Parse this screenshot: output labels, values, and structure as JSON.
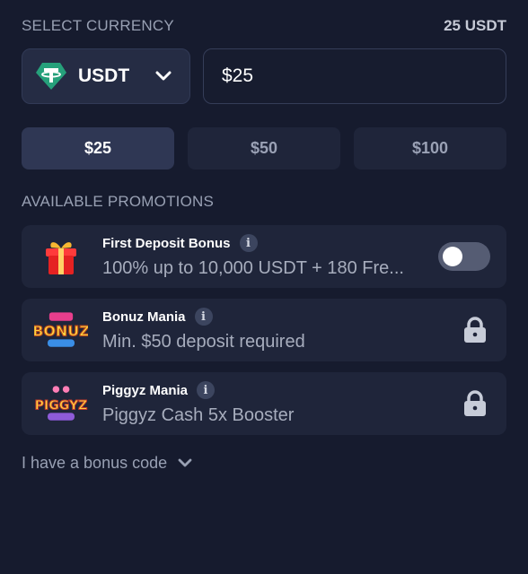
{
  "header": {
    "select_currency_label": "SELECT CURRENCY",
    "amount_display": "25 USDT"
  },
  "currency": {
    "selected": "USDT",
    "icon": "tether-icon",
    "brand_color": "#26a17b"
  },
  "amount_input": {
    "value": "$25",
    "placeholder": ""
  },
  "presets": [
    {
      "label": "$25",
      "active": true
    },
    {
      "label": "$50",
      "active": false
    },
    {
      "label": "$100",
      "active": false
    }
  ],
  "promotions": {
    "title": "AVAILABLE PROMOTIONS",
    "items": [
      {
        "name": "First Deposit Bonus",
        "description": "100% up to 10,000 USDT + 180 Fre...",
        "icon": "gift-icon",
        "control": "toggle",
        "enabled": false
      },
      {
        "name": "Bonuz Mania",
        "description": "Min. $50 deposit required",
        "icon": "bonuz-mania-logo",
        "logo_text": "BONUZ",
        "control": "lock"
      },
      {
        "name": "Piggyz Mania",
        "description": "Piggyz Cash 5x Booster",
        "icon": "piggyz-mania-logo",
        "logo_text": "PIGGYZ",
        "control": "lock"
      }
    ]
  },
  "bonus_code": {
    "label": "I have a bonus code"
  },
  "colors": {
    "background": "#161b2e",
    "card": "#1f253a",
    "muted_text": "#98a0b3"
  }
}
